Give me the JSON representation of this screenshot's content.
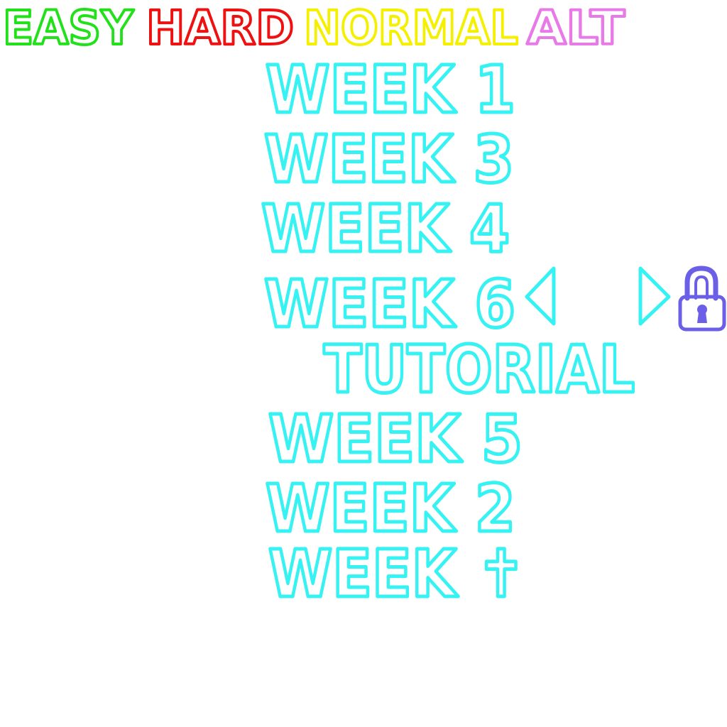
{
  "difficulties": [
    {
      "id": "easy",
      "label": "EASY",
      "color": "#22e01a"
    },
    {
      "id": "hard",
      "label": "HARD",
      "color": "#ee1111"
    },
    {
      "id": "normal",
      "label": "NORMAL",
      "color": "#f4f000"
    },
    {
      "id": "alt",
      "label": "ALT",
      "color": "#e87ae8"
    }
  ],
  "weeks": [
    {
      "id": "week-1",
      "label": "WEEK 1"
    },
    {
      "id": "week-3",
      "label": "WEEK 3"
    },
    {
      "id": "week-4",
      "label": "WEEK 4"
    },
    {
      "id": "week-6",
      "label": "WEEK 6"
    },
    {
      "id": "tutorial",
      "label": "TUTORIAL"
    },
    {
      "id": "week-5",
      "label": "WEEK 5"
    },
    {
      "id": "week-2",
      "label": "WEEK 2"
    },
    {
      "id": "week-cross",
      "label": "WEEK ✝"
    }
  ],
  "colors": {
    "week_outline": "#37f2f2",
    "arrow": "#37f2f2",
    "lock": "#6a5fe6"
  },
  "icons": {
    "left_arrow": "left-arrow-icon",
    "right_arrow": "right-arrow-icon",
    "lock": "lock-icon"
  }
}
